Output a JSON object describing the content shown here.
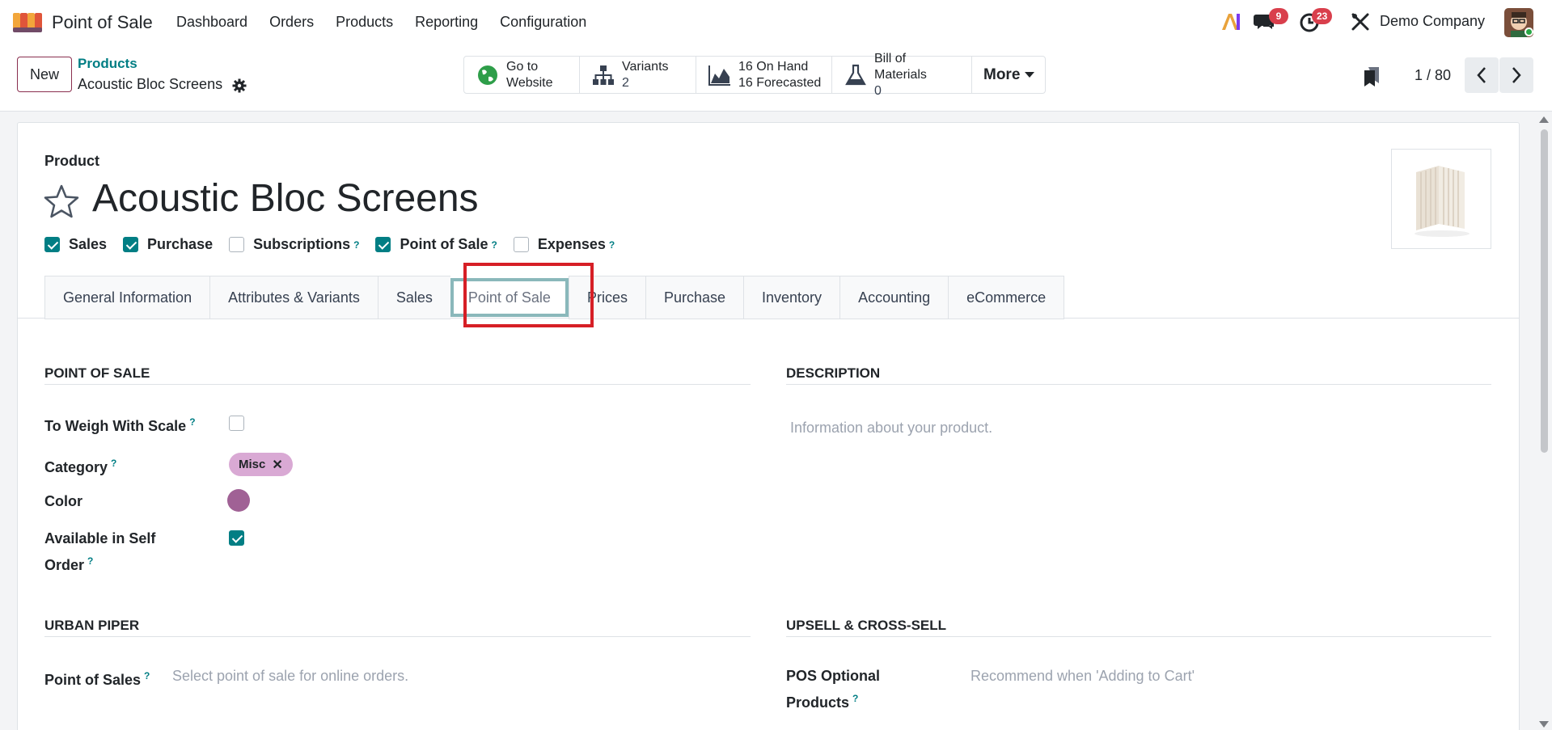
{
  "navbar": {
    "app_name": "Point of Sale",
    "menu": [
      "Dashboard",
      "Orders",
      "Products",
      "Reporting",
      "Configuration"
    ],
    "messages_count": "9",
    "activities_count": "23",
    "company": "Demo Company",
    "icons": [
      "app-logo-icon",
      "ai-icon",
      "chat-icon",
      "clock-icon",
      "tools-icon",
      "avatar"
    ]
  },
  "control": {
    "new_label": "New",
    "breadcrumb_parent": "Products",
    "breadcrumb_current": "Acoustic Bloc Screens",
    "stats": {
      "website_line1": "Go to",
      "website_line2": "Website",
      "variants_label": "Variants",
      "variants_value": "2",
      "onhand_line1": "16 On Hand",
      "onhand_line2": "16 Forecasted",
      "bom_label": "Bill of Materials",
      "bom_value": "0",
      "more_label": "More"
    },
    "pager": "1 / 80"
  },
  "form": {
    "product_label": "Product",
    "product_name": "Acoustic Bloc Screens",
    "flags": [
      {
        "label": "Sales",
        "checked": true,
        "help": false
      },
      {
        "label": "Purchase",
        "checked": true,
        "help": false
      },
      {
        "label": "Subscriptions",
        "checked": false,
        "help": true
      },
      {
        "label": "Point of Sale",
        "checked": true,
        "help": true
      },
      {
        "label": "Expenses",
        "checked": false,
        "help": true
      }
    ],
    "tabs": [
      "General Information",
      "Attributes & Variants",
      "Sales",
      "Point of Sale",
      "Prices",
      "Purchase",
      "Inventory",
      "Accounting",
      "eCommerce"
    ],
    "active_tab": "Point of Sale",
    "pos_section": {
      "title": "POINT OF SALE",
      "weigh_label": "To Weigh With Scale",
      "category_label": "Category",
      "category_tag": "Misc",
      "color_label": "Color",
      "color_value": "#a06195",
      "self_order_label_1": "Available in Self",
      "self_order_label_2": "Order"
    },
    "description_section": {
      "title": "DESCRIPTION",
      "placeholder": "Information about your product."
    },
    "urban_piper": {
      "title": "URBAN PIPER",
      "pos_label": "Point of Sales",
      "pos_placeholder": "Select point of sale for online orders."
    },
    "upsell": {
      "title": "UPSELL & CROSS-SELL",
      "optional_label_1": "POS Optional",
      "optional_label_2": "Products",
      "optional_placeholder": "Recommend when 'Adding to Cart'"
    }
  },
  "colors": {
    "accent": "#017e84",
    "brand": "#714b67",
    "badge": "#d93f4c",
    "highlight": "#d61f26",
    "tag": "#d9a9d4"
  }
}
